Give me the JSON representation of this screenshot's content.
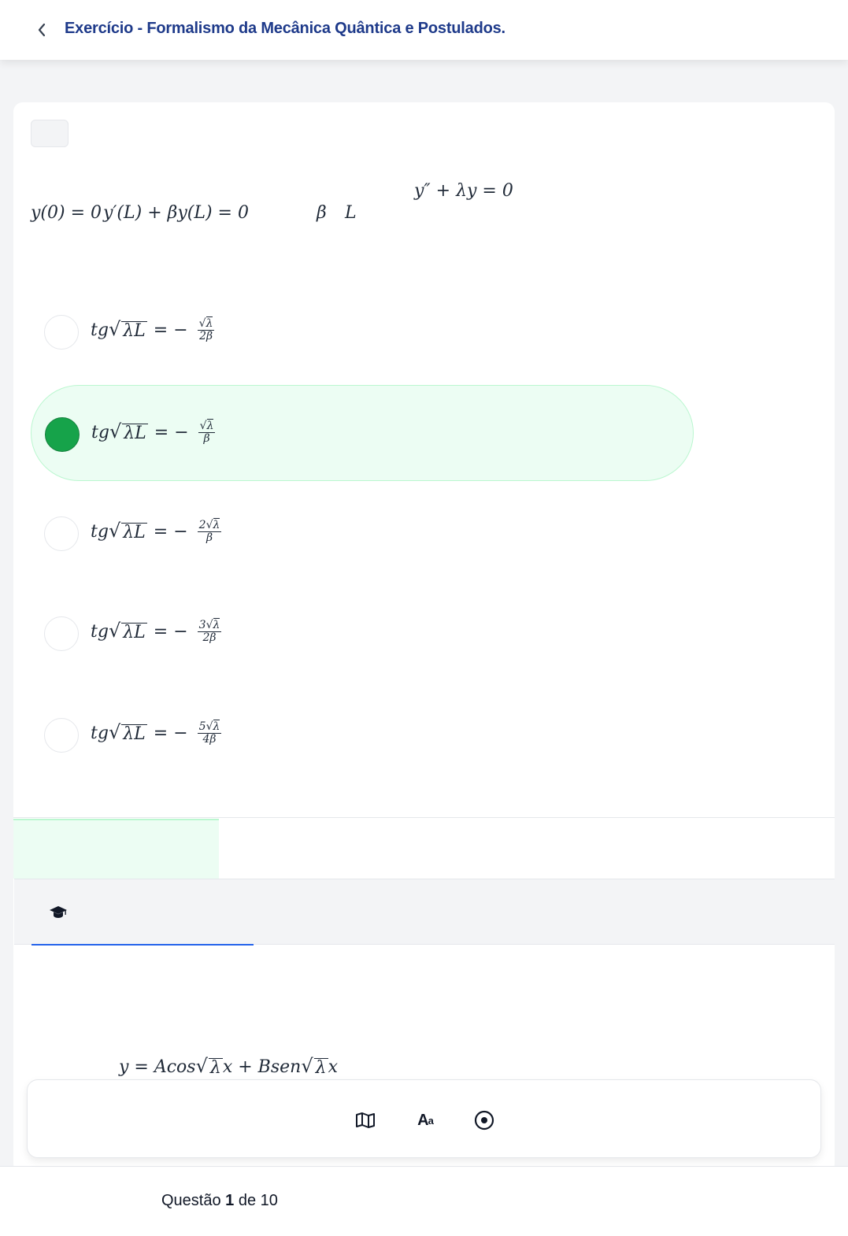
{
  "header": {
    "title": "Exercício - Formalismo da Mecânica Quântica e Postulados."
  },
  "statement": {
    "equation": "y″ + λy = 0",
    "condition_1": "y(0) = 0",
    "condition_2": "y′(L) + βy(L) = 0",
    "symbol_beta": "β",
    "symbol_L": "L"
  },
  "options": [
    {
      "lhs": "tg",
      "radicand": "λL",
      "sign": "= −",
      "num_coef": "",
      "num_rad": "λ",
      "den": "2β",
      "selected": false
    },
    {
      "lhs": "tg",
      "radicand": "λL",
      "sign": "= −",
      "num_coef": "",
      "num_rad": "λ",
      "den": "β",
      "selected": true
    },
    {
      "lhs": "tg",
      "radicand": "λL",
      "sign": "= −",
      "num_coef": "2",
      "num_rad": "λ",
      "den": "β",
      "selected": false
    },
    {
      "lhs": "tg",
      "radicand": "λL",
      "sign": "= −",
      "num_coef": "3",
      "num_rad": "λ",
      "den": "2β",
      "selected": false
    },
    {
      "lhs": "tg",
      "radicand": "λL",
      "sign": "= −",
      "num_coef": "5",
      "num_rad": "λ",
      "den": "4β",
      "selected": false
    }
  ],
  "solution": {
    "lhs": "y = Acos",
    "rad1": "λ",
    "mid": "x + Bsen",
    "rad2": "λ",
    "end": "x"
  },
  "toolbar": {
    "font_label_big": "A",
    "font_label_small": "a"
  },
  "footer": {
    "prefix": "Questão ",
    "current": "1",
    "suffix": " de 10"
  },
  "colors": {
    "accent_green": "#16a34a",
    "selected_bg": "#ecfdf3",
    "title_blue": "#1e3a8a",
    "tab_underline": "#2563eb"
  }
}
